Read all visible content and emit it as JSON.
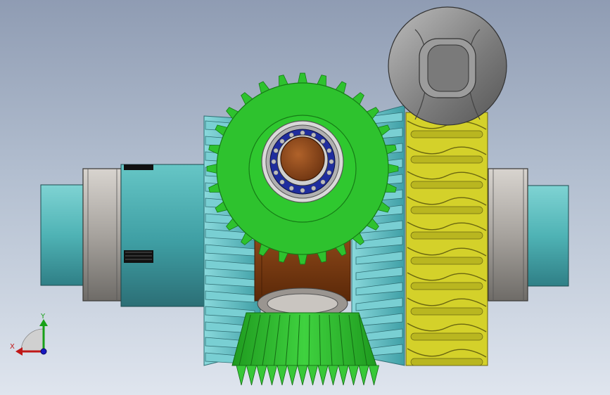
{
  "viewport": {
    "background_top": "#8f9cb3",
    "background_bottom": "#dfe5ee"
  },
  "parts": {
    "shaft_color": "#4fb3b5",
    "bearing_color": "#a7a39e",
    "bevel_gear_teal": "#5cc3c8",
    "bevel_gear_green": "#2ec22e",
    "bevel_gear_green_dark": "#22a022",
    "spider_color": "#7a3a12",
    "hub_blue": "#1f2d9e",
    "hub_bronze": "#8e4a1e",
    "worm_wheel_color": "#d4d12a",
    "worm_color": "#8c8c8c"
  },
  "triad": {
    "x_label": "X",
    "y_label": "Y",
    "x_color": "#c01818",
    "y_color": "#18a018",
    "z_color": "#1818c0"
  }
}
